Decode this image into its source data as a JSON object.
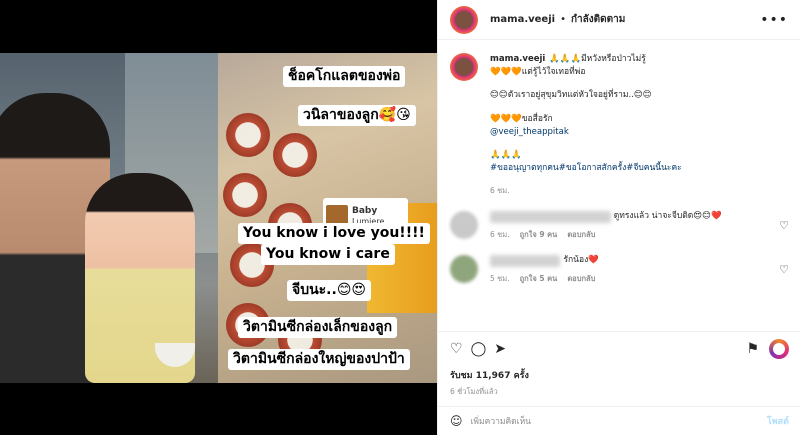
{
  "header": {
    "username": "mama.veeji",
    "separator": "•",
    "follow_status": "กำลังติดตาม",
    "more": "•••"
  },
  "video": {
    "captions": [
      "ช็อคโกแลตของพ่อ",
      "วนิลาของลูก🥰😘",
      "You know i love you!!!!",
      "You know i care",
      "จีบนะ..😊😍",
      "วิตามินซีกล่องเล็กของลูก",
      "วิตามินซีกล่องใหญ่ของปาป้า"
    ],
    "sticker_title": "Baby",
    "sticker_sub": "Lumiere",
    "speaker": "🔈"
  },
  "post_caption": {
    "username": "mama.veeji",
    "line1": "🙏🙏🙏มีหวังหรือป่าวไม่รู้",
    "line2": "🧡🧡🧡แต่รู้ไว้ใจเทอที่พ่อ",
    "line3": "😊😊ตัวเราอยู่สุขุมวิทแต่หัวใจอยู่ที่ราม..😊😊",
    "line4": "🧡🧡🧡ขอสื่อรัก",
    "mention": "@veeji_theappitak",
    "line5": "🙏🙏🙏",
    "hashtags": "#ขออนุญาตทุกคน#ขอโอกาสสักครั้ง#จีบคนนี้นะคะ",
    "time": "6 ชม."
  },
  "comments": [
    {
      "text": "ดูทรงแล้ว น่าจะจีบติด😍😊❤️",
      "time": "6 ชม.",
      "likes": "ถูกใจ 9 คน",
      "reply": "ตอบกลับ"
    },
    {
      "text": "รักน้อง❤️",
      "time": "5 ชม.",
      "likes": "ถูกใจ 5 คน",
      "reply": "ตอบกลับ"
    }
  ],
  "actions": {
    "like_icon": "heart-icon",
    "comment_icon": "comment-icon",
    "share_icon": "share-icon",
    "save_icon": "bookmark-icon",
    "views": "รับชม 11,967 ครั้ง",
    "posted": "6 ชั่วโมงที่แล้ว"
  },
  "add_comment": {
    "placeholder": "เพิ่มความคิดเห็น",
    "post_label": "โพสต์"
  }
}
